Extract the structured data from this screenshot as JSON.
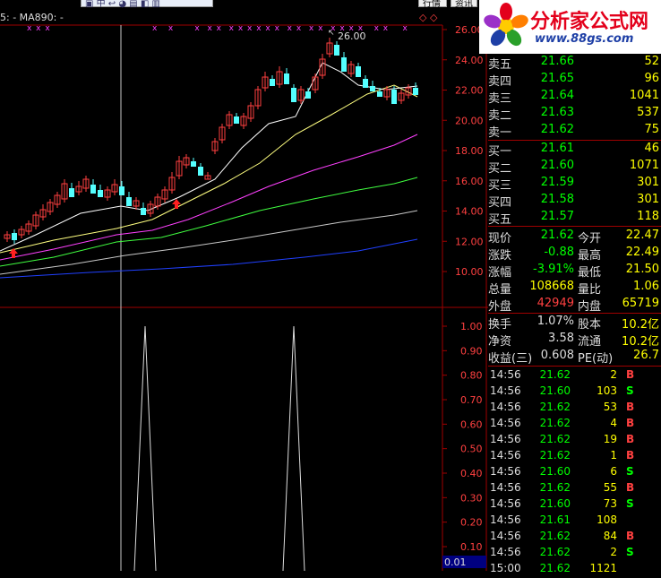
{
  "top": {
    "ma_label": "5: -  MA890: -",
    "tabs": [
      "行情",
      "资讯"
    ]
  },
  "logo": {
    "title": "分析家公式网",
    "url": "www.88gs.com"
  },
  "main_chart": {
    "price_axis": [
      "26.00",
      "24.00",
      "22.00",
      "20.00",
      "18.00",
      "16.00",
      "14.00",
      "12.00",
      "10.00"
    ],
    "high_marker": "26.00"
  },
  "indicator_chart": {
    "axis": [
      "1.00",
      "0.90",
      "0.80",
      "0.70",
      "0.60",
      "0.50",
      "0.40",
      "0.30",
      "0.20",
      "0.10"
    ],
    "current_value": "0.01"
  },
  "order_book": {
    "asks": [
      {
        "label": "卖五",
        "price": "21.66",
        "vol": "52"
      },
      {
        "label": "卖四",
        "price": "21.65",
        "vol": "96"
      },
      {
        "label": "卖三",
        "price": "21.64",
        "vol": "1041"
      },
      {
        "label": "卖二",
        "price": "21.63",
        "vol": "537"
      },
      {
        "label": "卖一",
        "price": "21.62",
        "vol": "75"
      }
    ],
    "bids": [
      {
        "label": "买一",
        "price": "21.61",
        "vol": "46"
      },
      {
        "label": "买二",
        "price": "21.60",
        "vol": "1071"
      },
      {
        "label": "买三",
        "price": "21.59",
        "vol": "301"
      },
      {
        "label": "买四",
        "price": "21.58",
        "vol": "301"
      },
      {
        "label": "买五",
        "price": "21.57",
        "vol": "118"
      }
    ]
  },
  "stats": [
    {
      "l1": "现价",
      "v1": "21.62",
      "c1": "g",
      "l2": "今开",
      "v2": "22.47",
      "c2": "r"
    },
    {
      "l1": "涨跌",
      "v1": "-0.88",
      "c1": "g",
      "l2": "最高",
      "v2": "22.49",
      "c2": "r"
    },
    {
      "l1": "涨幅",
      "v1": "-3.91%",
      "c1": "g",
      "l2": "最低",
      "v2": "21.50",
      "c2": "g"
    },
    {
      "l1": "总量",
      "v1": "108668",
      "c1": "y",
      "l2": "量比",
      "v2": "1.06",
      "c2": "r"
    },
    {
      "l1": "外盘",
      "v1": "42949",
      "c1": "r",
      "l2": "内盘",
      "v2": "65719",
      "c2": "g"
    }
  ],
  "stats2": [
    {
      "l1": "换手",
      "v1": "1.07%",
      "c1": "w",
      "l2": "股本",
      "v2": "10.2亿",
      "c2": "w"
    },
    {
      "l1": "净资",
      "v1": "3.58",
      "c1": "w",
      "l2": "流通",
      "v2": "10.2亿",
      "c2": "w"
    },
    {
      "l1": "收益(三)",
      "v1": "0.608",
      "c1": "w",
      "l2": "PE(动)",
      "v2": "26.7",
      "c2": "w"
    }
  ],
  "ticks": [
    {
      "time": "14:56",
      "price": "21.62",
      "vol": "2",
      "side": "B"
    },
    {
      "time": "14:56",
      "price": "21.60",
      "vol": "103",
      "side": "S"
    },
    {
      "time": "14:56",
      "price": "21.62",
      "vol": "53",
      "side": "B"
    },
    {
      "time": "14:56",
      "price": "21.62",
      "vol": "4",
      "side": "B"
    },
    {
      "time": "14:56",
      "price": "21.62",
      "vol": "19",
      "side": "B"
    },
    {
      "time": "14:56",
      "price": "21.62",
      "vol": "1",
      "side": "B"
    },
    {
      "time": "14:56",
      "price": "21.60",
      "vol": "6",
      "side": "S"
    },
    {
      "time": "14:56",
      "price": "21.62",
      "vol": "55",
      "side": "B"
    },
    {
      "time": "14:56",
      "price": "21.60",
      "vol": "73",
      "side": "S"
    },
    {
      "time": "14:56",
      "price": "21.61",
      "vol": "108",
      "side": ""
    },
    {
      "time": "14:56",
      "price": "21.62",
      "vol": "84",
      "side": "B"
    },
    {
      "time": "14:56",
      "price": "21.62",
      "vol": "2",
      "side": "S"
    },
    {
      "time": "15:00",
      "price": "21.62",
      "vol": "1121",
      "side": ""
    }
  ],
  "colors": {
    "up": "#ff4040",
    "down": "#54ffff",
    "grid": "#800000",
    "ma5": "#ffffff",
    "ma10": "#ffff80",
    "ma20": "#ff40ff",
    "ma30": "#40ff40",
    "ma60": "#c8c8c8",
    "ma120": "#2040ff"
  }
}
